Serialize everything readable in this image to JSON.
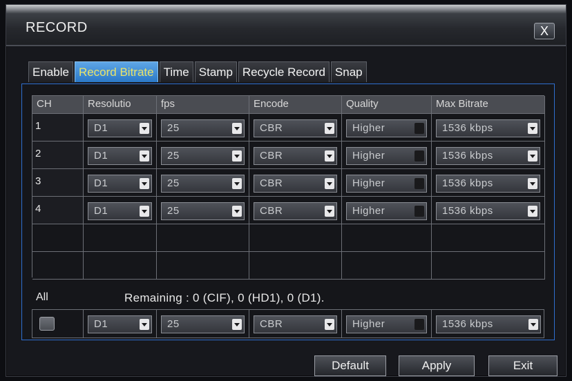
{
  "window": {
    "title": "RECORD",
    "close_label": "X"
  },
  "tabs": [
    {
      "label": "Enable",
      "active": false
    },
    {
      "label": "Record Bitrate",
      "active": true
    },
    {
      "label": "Time",
      "active": false
    },
    {
      "label": "Stamp",
      "active": false
    },
    {
      "label": "Recycle Record",
      "active": false
    },
    {
      "label": "Snap",
      "active": false
    }
  ],
  "table": {
    "headers": [
      "CH",
      "Resolutio",
      "fps",
      "Encode",
      "Quality",
      "Max Bitrate"
    ],
    "rows": [
      {
        "ch": "1",
        "resolution": "D1",
        "fps": "25",
        "encode": "CBR",
        "quality": "Higher",
        "max_bitrate": "1536 kbps"
      },
      {
        "ch": "2",
        "resolution": "D1",
        "fps": "25",
        "encode": "CBR",
        "quality": "Higher",
        "max_bitrate": "1536 kbps"
      },
      {
        "ch": "3",
        "resolution": "D1",
        "fps": "25",
        "encode": "CBR",
        "quality": "Higher",
        "max_bitrate": "1536 kbps"
      },
      {
        "ch": "4",
        "resolution": "D1",
        "fps": "25",
        "encode": "CBR",
        "quality": "Higher",
        "max_bitrate": "1536 kbps"
      }
    ]
  },
  "all_section": {
    "label": "All",
    "remaining": "Remaining : 0 (CIF), 0 (HD1), 0 (D1).",
    "resolution": "D1",
    "fps": "25",
    "encode": "CBR",
    "quality": "Higher",
    "max_bitrate": "1536 kbps"
  },
  "buttons": {
    "default": "Default",
    "apply": "Apply",
    "exit": "Exit"
  },
  "colors": {
    "active_tab": "#3a8ad6",
    "active_tab_text": "#e8e36a",
    "panel_border": "#2f6fd0"
  }
}
